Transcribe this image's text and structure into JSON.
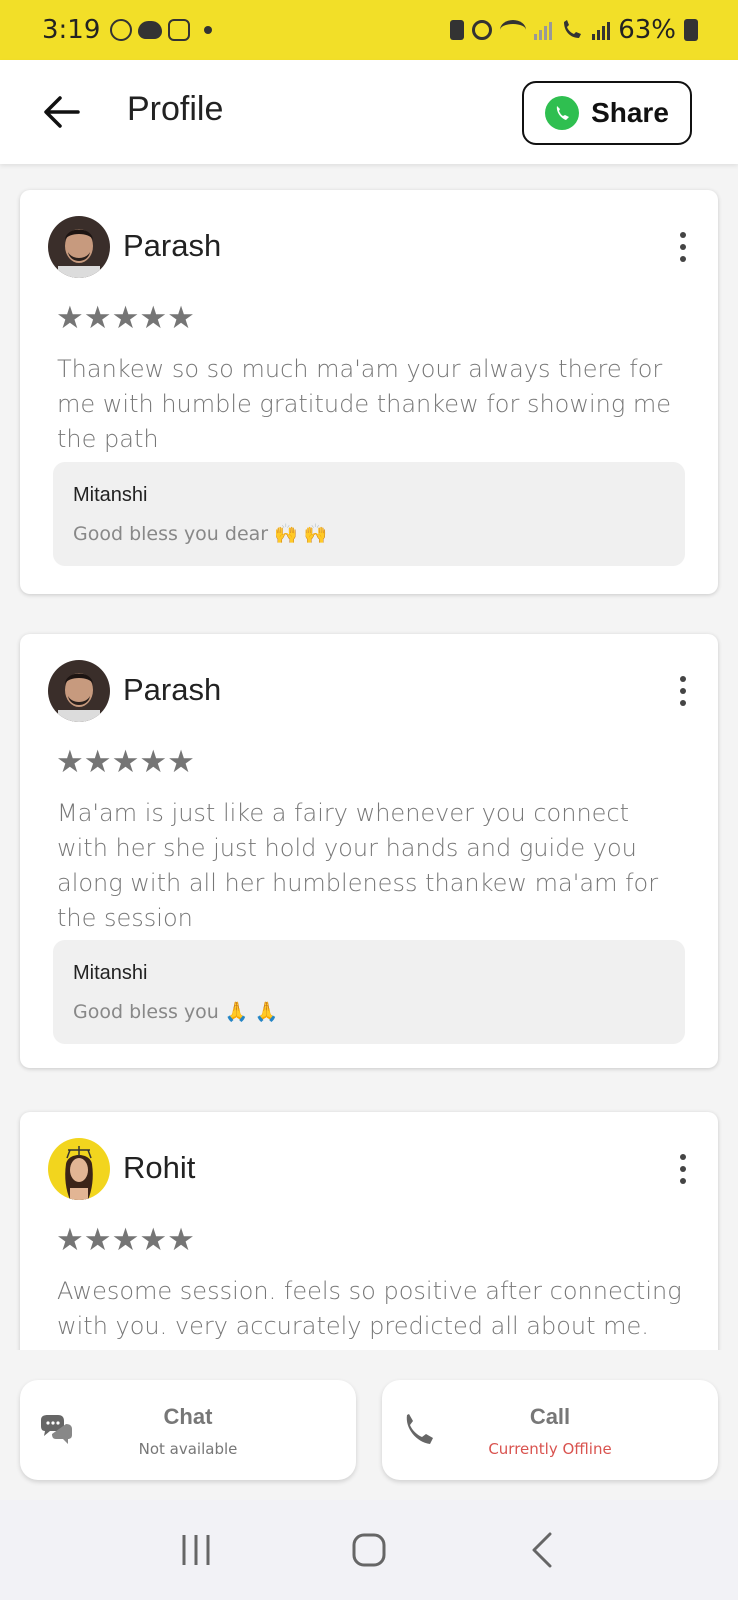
{
  "status_bar": {
    "time": "3:19",
    "battery": "63%"
  },
  "header": {
    "title": "Profile",
    "share_label": "Share"
  },
  "reviews": [
    {
      "name": "Parash",
      "stars": "★★★★★",
      "text": "Thankew so so much ma'am your always there for me with humble gratitude thankew for showing me the path",
      "reply": {
        "name": "Mitanshi",
        "text": "Good bless you dear 🙌 🙌"
      }
    },
    {
      "name": "Parash",
      "stars": "★★★★★",
      "text": "Ma'am is just like a fairy whenever you connect with her she just hold your hands and guide you along with all her humbleness thankew ma'am for the session",
      "reply": {
        "name": "Mitanshi",
        "text": "Good bless you 🙏 🙏"
      }
    },
    {
      "name": "Rohit",
      "stars": "★★★★★",
      "text": "Awesome session. feels so positive after connecting with you. very accurately predicted all about me."
    }
  ],
  "actions": {
    "chat": {
      "title": "Chat",
      "status": "Not available"
    },
    "call": {
      "title": "Call",
      "status": "Currently Offline"
    }
  },
  "colors": {
    "status_bar_bg": "#f2df28",
    "whatsapp_green": "#2fbf50",
    "offline_red": "#d9534f"
  }
}
